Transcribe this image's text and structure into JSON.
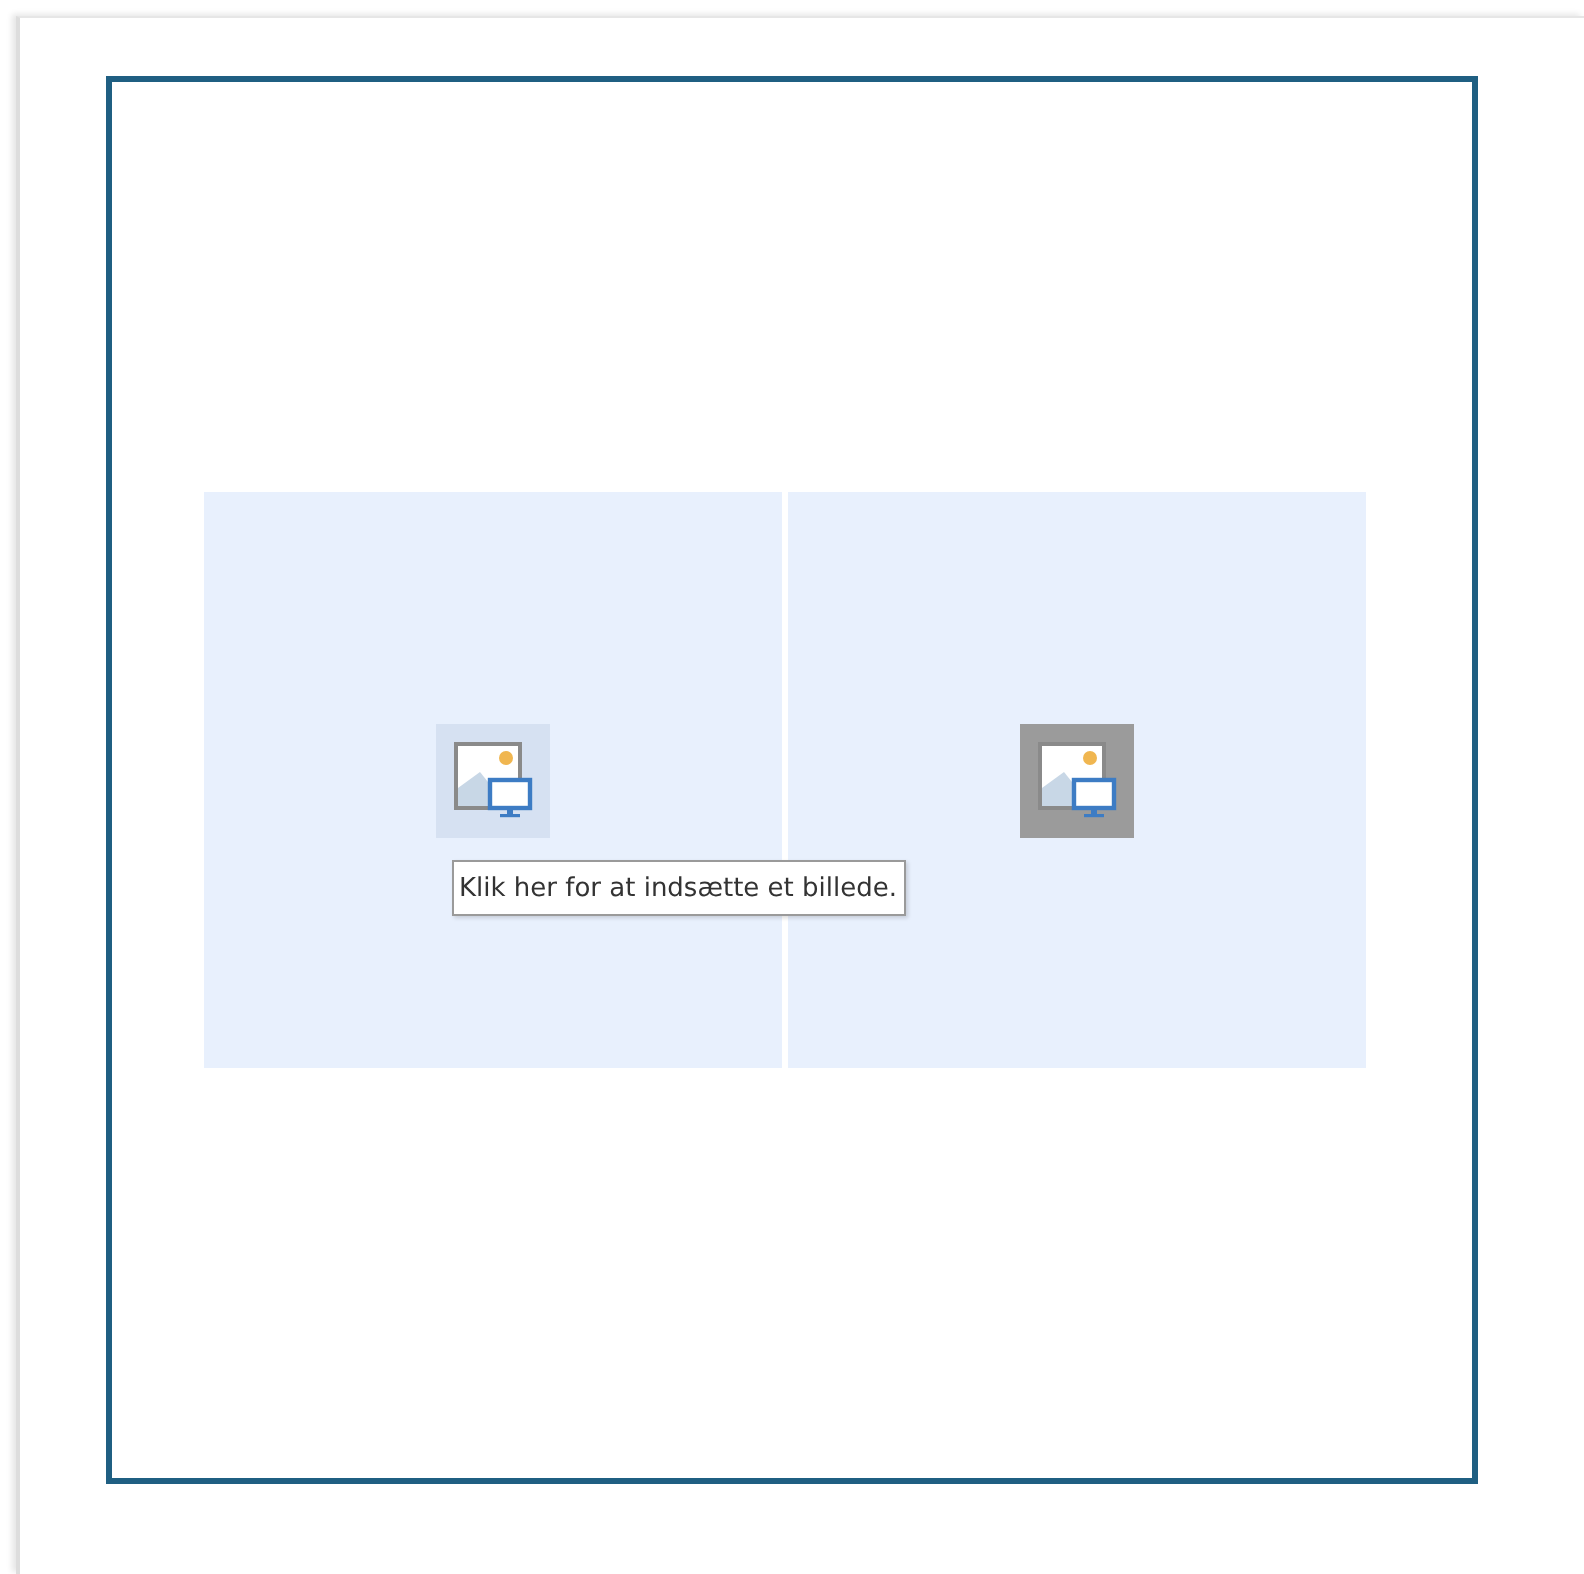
{
  "placeholders": [
    {
      "hovered": true,
      "selected": false,
      "tooltip": "Klik her for at indsætte et billede."
    },
    {
      "hovered": false,
      "selected": true
    }
  ]
}
